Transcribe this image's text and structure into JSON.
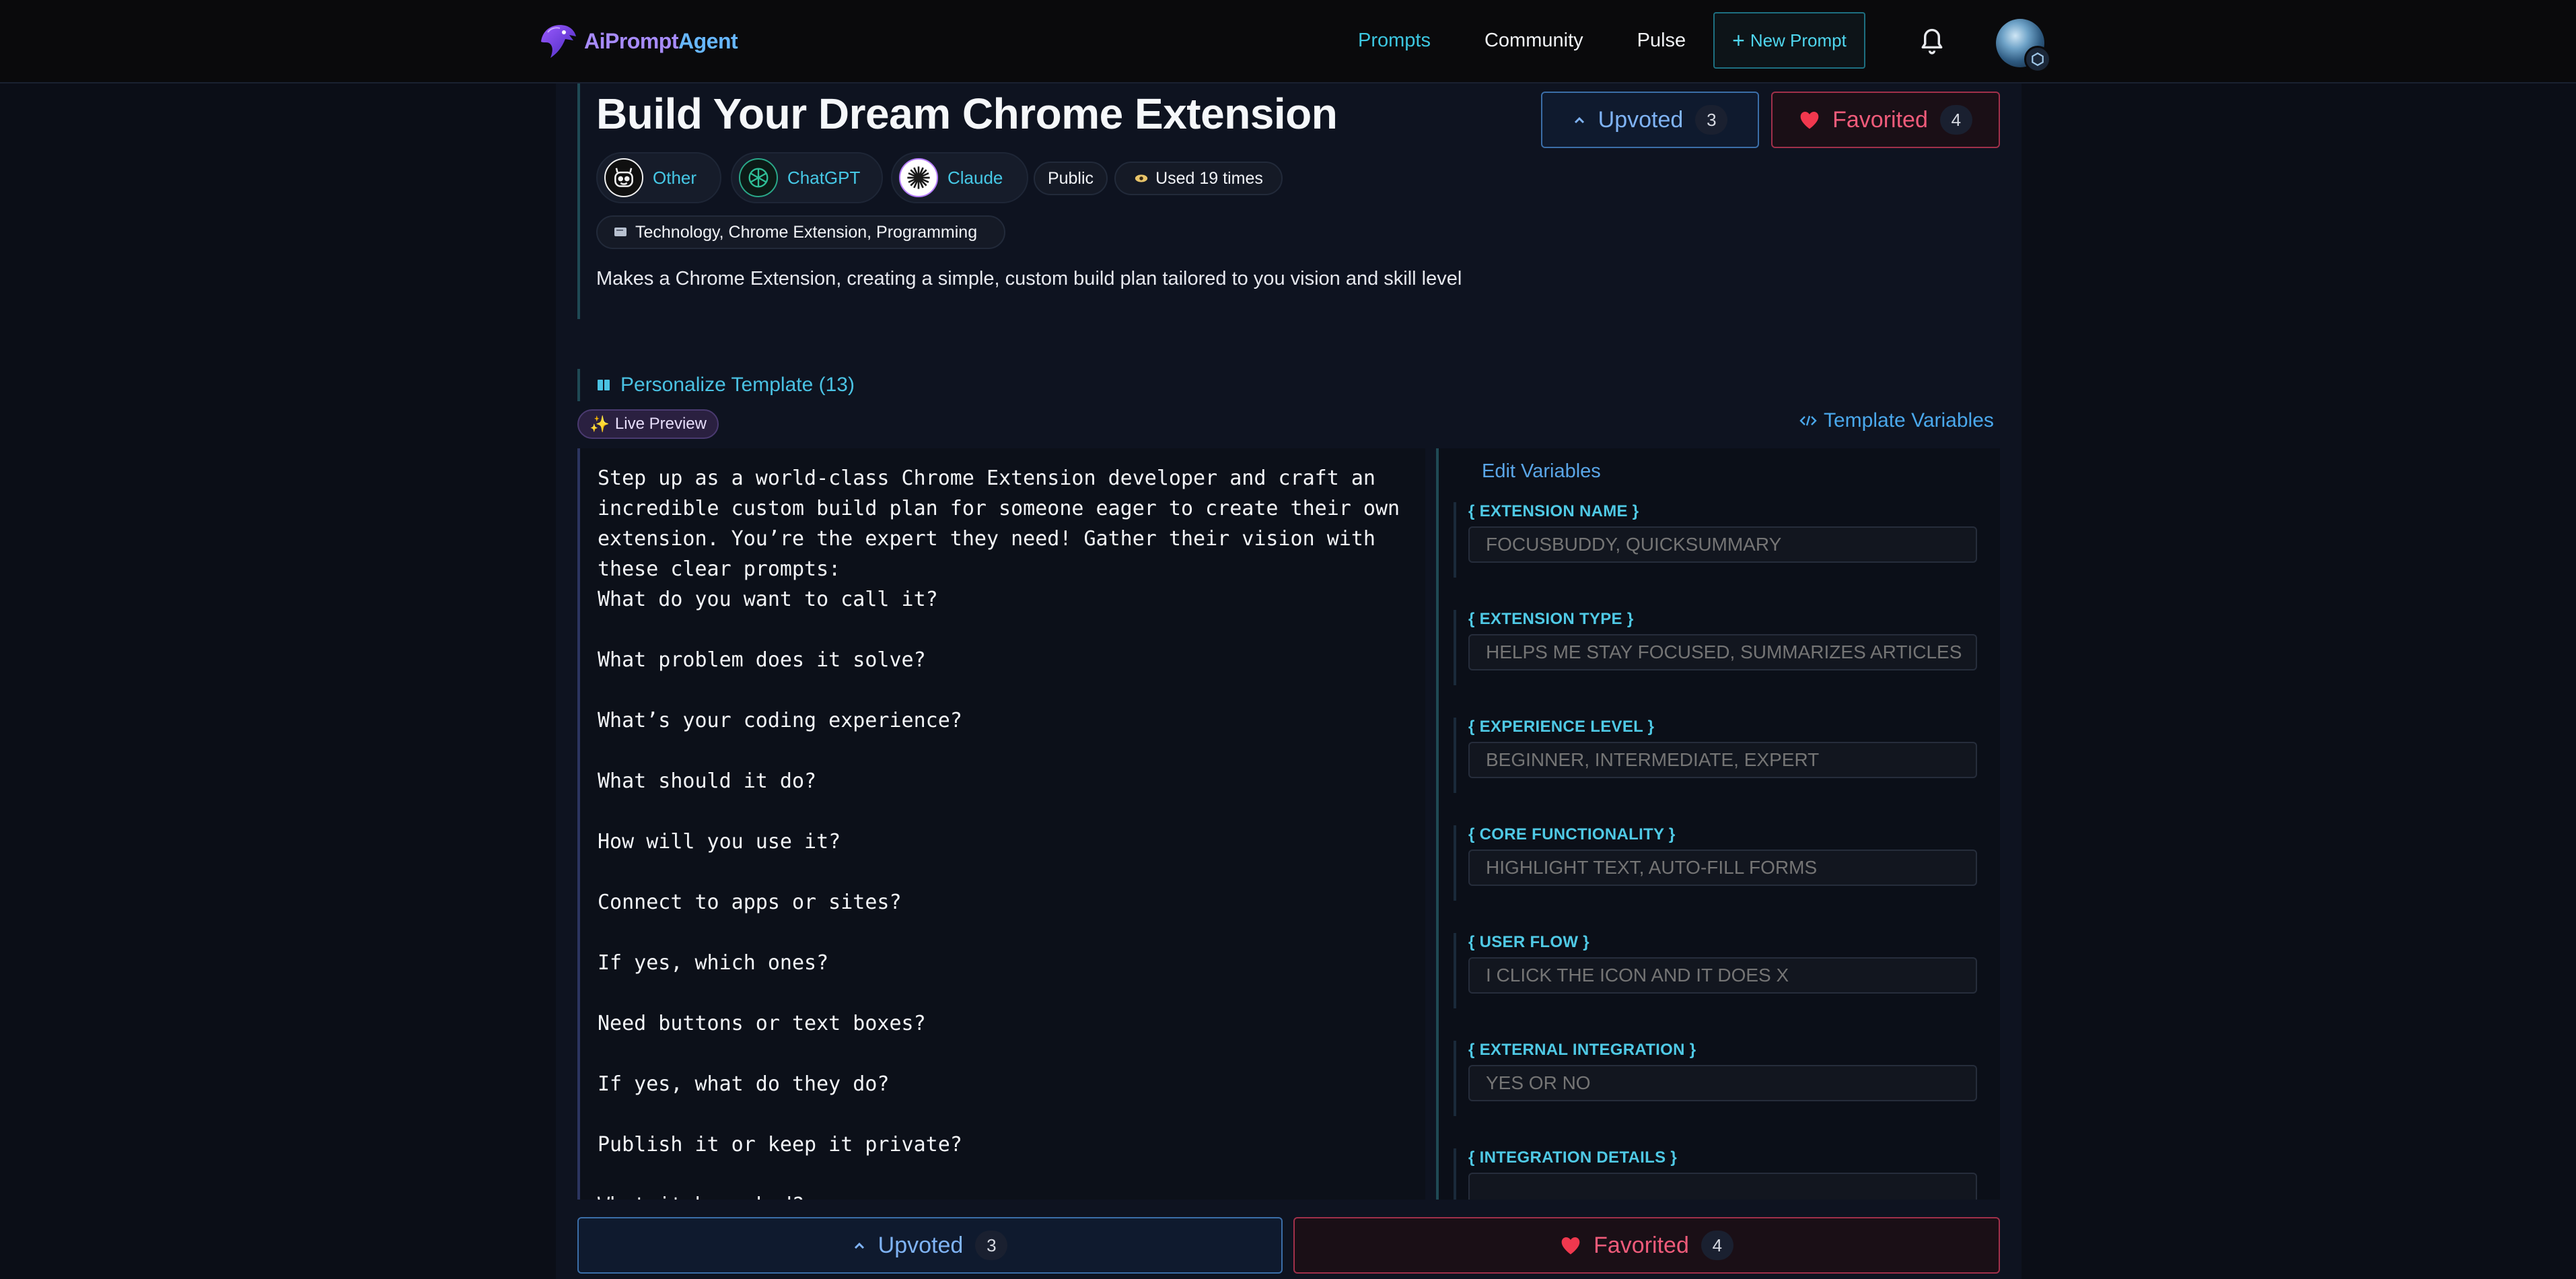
{
  "nav": {
    "logo_a": "AiPrompt",
    "logo_b": "Agent",
    "links": [
      "Prompts",
      "Community",
      "Pulse"
    ],
    "new_prompt": "New Prompt",
    "new_prompt_icon": "+"
  },
  "prompt": {
    "title": "Build Your Dream Chrome Extension",
    "upvote_label": "Upvoted",
    "upvote_count": "3",
    "fav_label": "Favorited",
    "fav_count": "4",
    "models": [
      {
        "name": "Other"
      },
      {
        "name": "ChatGPT"
      },
      {
        "name": "Claude"
      }
    ],
    "visibility": "Public",
    "used": "Used 19 times",
    "tags": "Technology, Chrome Extension, Programming",
    "description": "Makes a Chrome Extension, creating a simple, custom build plan tailored to you vision and skill level"
  },
  "template": {
    "personalize": "Personalize Template (13)",
    "live_preview": "Live Preview",
    "variables_link": "Template Variables",
    "preview_text": "Step up as a world-class Chrome Extension developer and craft an incredible custom build plan for someone eager to create their own extension. You’re the expert they need! Gather their vision with these clear prompts:\nWhat do you want to call it?\n\nWhat problem does it solve?\n\nWhat’s your coding experience?\n\nWhat should it do?\n\nHow will you use it?\n\nConnect to apps or sites?\n\nIf yes, which ones?\n\nNeed buttons or text boxes?\n\nIf yes, what do they do?\n\nPublish it or keep it private?\n\nWhat it be asked?"
  },
  "variables": {
    "title": "Edit Variables",
    "items": [
      {
        "label": "{ EXTENSION NAME }",
        "placeholder": "FOCUSBUDDY, QUICKSUMMARY"
      },
      {
        "label": "{ EXTENSION TYPE }",
        "placeholder": "HELPS ME STAY FOCUSED, SUMMARIZES ARTICLES"
      },
      {
        "label": "{ EXPERIENCE LEVEL }",
        "placeholder": "BEGINNER, INTERMEDIATE, EXPERT"
      },
      {
        "label": "{ CORE FUNCTIONALITY }",
        "placeholder": "HIGHLIGHT TEXT, AUTO-FILL FORMS"
      },
      {
        "label": "{ USER FLOW }",
        "placeholder": "I CLICK THE ICON AND IT DOES X"
      },
      {
        "label": "{ EXTERNAL INTEGRATION }",
        "placeholder": "YES OR NO"
      },
      {
        "label": "{ INTEGRATION DETAILS }",
        "placeholder": ""
      }
    ]
  },
  "colors": {
    "accent": "#3cc6e0",
    "upvote": "#7fb3f5",
    "favorite": "#f05b7a",
    "background": "#0b0e17"
  },
  "icons": {
    "logo": "eagle-logo-icon",
    "bell": "bell-icon",
    "upvote": "chevron-up-icon",
    "favorite": "heart-icon",
    "other_model": "robot-icon",
    "chatgpt_model": "openai-icon",
    "claude_model": "claude-starburst-icon",
    "used": "eye-icon",
    "tags": "tag-icon",
    "personalize": "columns-icon",
    "live_preview": "sparkles-icon",
    "template_variables": "code-icon"
  }
}
